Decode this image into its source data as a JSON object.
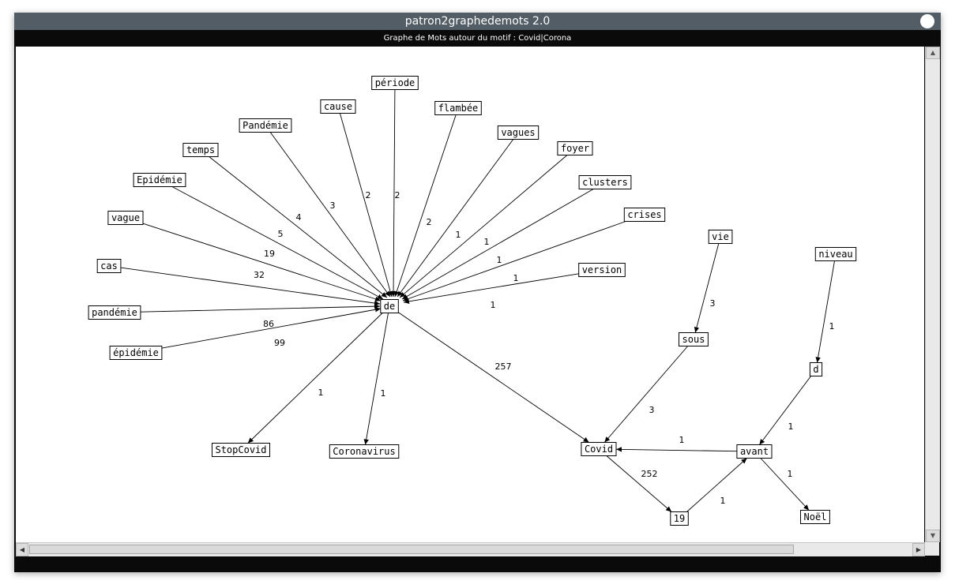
{
  "window": {
    "title": "patron2graphedemots 2.0",
    "subtitle": "Graphe de Mots autour du motif : Covid|Corona"
  },
  "scrollbars": {
    "up_arrow": "▲",
    "down_arrow": "▼",
    "left_arrow": "◀",
    "right_arrow": "▶"
  },
  "graph": {
    "nodes": [
      {
        "id": "periode",
        "label": "période"
      },
      {
        "id": "cause",
        "label": "cause"
      },
      {
        "id": "flambee",
        "label": "flambée"
      },
      {
        "id": "Pandemie",
        "label": "Pandémie"
      },
      {
        "id": "vagues",
        "label": "vagues"
      },
      {
        "id": "temps",
        "label": "temps"
      },
      {
        "id": "foyer",
        "label": "foyer"
      },
      {
        "id": "Epidemie",
        "label": "Epidémie"
      },
      {
        "id": "clusters",
        "label": "clusters"
      },
      {
        "id": "vague",
        "label": "vague"
      },
      {
        "id": "crises",
        "label": "crises"
      },
      {
        "id": "vie",
        "label": "vie"
      },
      {
        "id": "niveau",
        "label": "niveau"
      },
      {
        "id": "cas",
        "label": "cas"
      },
      {
        "id": "version",
        "label": "version"
      },
      {
        "id": "de",
        "label": "de"
      },
      {
        "id": "pandemie",
        "label": "pandémie"
      },
      {
        "id": "epidemie",
        "label": "épidémie"
      },
      {
        "id": "sous",
        "label": "sous"
      },
      {
        "id": "d",
        "label": "d"
      },
      {
        "id": "StopCovid",
        "label": "StopCovid"
      },
      {
        "id": "Coronavirus",
        "label": "Coronavirus"
      },
      {
        "id": "Covid",
        "label": "Covid"
      },
      {
        "id": "avant",
        "label": "avant"
      },
      {
        "id": "n19",
        "label": "19"
      },
      {
        "id": "Noel",
        "label": "Noël"
      }
    ],
    "edges": [
      {
        "from": "periode",
        "to": "de",
        "weight": "2"
      },
      {
        "from": "cause",
        "to": "de",
        "weight": "2"
      },
      {
        "from": "flambee",
        "to": "de",
        "weight": "2"
      },
      {
        "from": "Pandemie",
        "to": "de",
        "weight": "3"
      },
      {
        "from": "vagues",
        "to": "de",
        "weight": "1"
      },
      {
        "from": "temps",
        "to": "de",
        "weight": "4"
      },
      {
        "from": "foyer",
        "to": "de",
        "weight": "1"
      },
      {
        "from": "Epidemie",
        "to": "de",
        "weight": "5"
      },
      {
        "from": "clusters",
        "to": "de",
        "weight": "1"
      },
      {
        "from": "vague",
        "to": "de",
        "weight": "19"
      },
      {
        "from": "crises",
        "to": "de",
        "weight": "1"
      },
      {
        "from": "cas",
        "to": "de",
        "weight": "32"
      },
      {
        "from": "version",
        "to": "de",
        "weight": "1"
      },
      {
        "from": "pandemie",
        "to": "de",
        "weight": "86"
      },
      {
        "from": "epidemie",
        "to": "de",
        "weight": "99"
      },
      {
        "from": "de",
        "to": "StopCovid",
        "weight": "1"
      },
      {
        "from": "de",
        "to": "Coronavirus",
        "weight": "1"
      },
      {
        "from": "de",
        "to": "Covid",
        "weight": "257"
      },
      {
        "from": "vie",
        "to": "sous",
        "weight": "3"
      },
      {
        "from": "sous",
        "to": "Covid",
        "weight": "3"
      },
      {
        "from": "niveau",
        "to": "d",
        "weight": "1"
      },
      {
        "from": "d",
        "to": "avant",
        "weight": "1"
      },
      {
        "from": "avant",
        "to": "Covid",
        "weight": "1"
      },
      {
        "from": "Covid",
        "to": "n19",
        "weight": "252"
      },
      {
        "from": "n19",
        "to": "avant",
        "weight": "1"
      },
      {
        "from": "avant",
        "to": "Noel",
        "weight": "1"
      }
    ]
  }
}
